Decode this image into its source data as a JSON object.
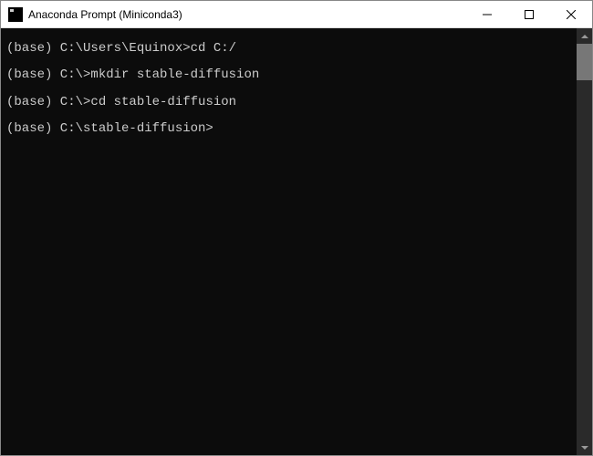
{
  "window": {
    "title": "Anaconda Prompt (Miniconda3)"
  },
  "terminal": {
    "lines": [
      {
        "prompt": "(base) C:\\Users\\Equinox>",
        "command": "cd C:/"
      },
      {
        "prompt": "(base) C:\\>",
        "command": "mkdir stable-diffusion"
      },
      {
        "prompt": "(base) C:\\>",
        "command": "cd stable-diffusion"
      },
      {
        "prompt": "(base) C:\\stable-diffusion>",
        "command": ""
      }
    ]
  }
}
